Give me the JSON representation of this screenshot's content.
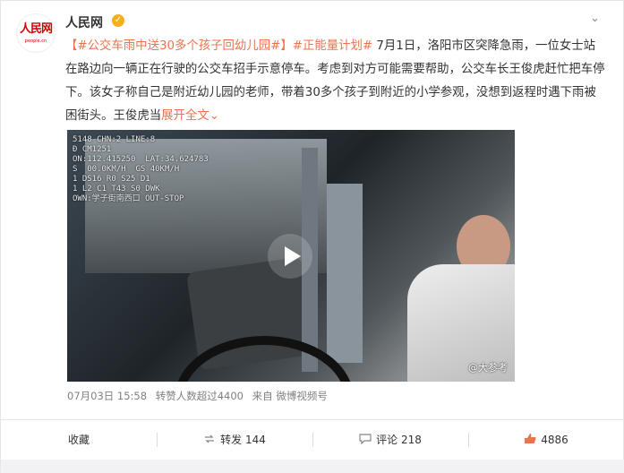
{
  "author": {
    "name": "人民网",
    "avatar_text": "人民网",
    "avatar_sub": "people.cn",
    "verified_icon": "verified-badge-icon",
    "menu_icon": "chevron-down-icon"
  },
  "post": {
    "bracket_open": "【",
    "topic_tag": "#公交车雨中送30多个孩子回幼儿园#",
    "bracket_close": "】",
    "positive_tag": "#正能量计划#",
    "text": " 7月1日，洛阳市区突降急雨，一位女士站在路边向一辆正在行驶的公交车招手示意停车。考虑到对方可能需要帮助，公交车长王俊虎赶忙把车停下。该女子称自己是附近幼儿园的老师，带着30多个孩子到附近的小学参观，没想到返程时遇下雨被困街头。王俊虎当",
    "expand_label": "展开全文",
    "expand_icon": "chevron-down-icon"
  },
  "video": {
    "osd_lines": [
      "5148 CHN:2 LINE:8",
      "Đ CM1251",
      "ON:112.415250  LAT:34.624783",
      "S  00.0KM/H  GS 40KM/H",
      "1 DS16 R0 S25 D1",
      "1 L2 C1 T43 S0 DWK",
      "OWN:学子街南西口 OUT-STOP"
    ],
    "watermark": "@大参考",
    "play_icon": "play-icon"
  },
  "meta": {
    "date": "07月03日 15:58",
    "reposts_note": "转赞人数超过4400",
    "source": "来自 微博视频号"
  },
  "actions": {
    "favorite_label": "收藏",
    "repost_label": "转发",
    "repost_count": "144",
    "comment_label": "评论",
    "comment_count": "218",
    "like_count": "4886"
  },
  "colors": {
    "accent": "#eb7350",
    "like": "#eb7350"
  }
}
